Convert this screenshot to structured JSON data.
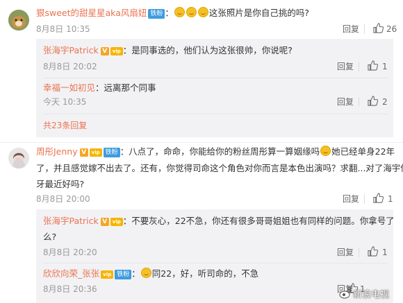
{
  "colors": {
    "accent": "#eb7350",
    "badge": "#3e9cde",
    "vip": "#f7b500",
    "panel": "#f2f2f5"
  },
  "labels": {
    "reply": "回复",
    "fan_badge": "铁粉",
    "v_badge": "V",
    "vip_badge": "vip"
  },
  "comment1": {
    "user": "狠sweet的甜星星aka风扇妞",
    "text": "这张照片是你自己挑的吗?",
    "time": "8月8日 10:35",
    "likes": "26",
    "replies": [
      {
        "user": "张海宇Patrick",
        "text": "是同事选的，他们认为这张很帅，你说呢?",
        "time": "8月8日 20:02",
        "likes": "1"
      },
      {
        "user": "幸福一如初见",
        "text": "远离那个同事",
        "time": "今天 10:35",
        "likes": "2"
      }
    ],
    "more": "共23条回复"
  },
  "comment2": {
    "user": "周彤Jenny",
    "text_line1_a": "八点了，命命，你能给你的粉丝周彤算一算姻缘吗",
    "text_line1_b": "她已经单身22年",
    "text_line2": "了，并且感觉嫁不出去了。还有，你觉得司命这个角色对你而言是本色出演吗？求翻...对了海宇你",
    "text_line3": "牙最近好吗?",
    "time": "8月8日 20:00",
    "likes": "1",
    "replies": [
      {
        "user": "张海宇Patrick",
        "text_line1": "不要灰心，22不急，你还有很多哥哥姐姐也有同样的问题。你拿号了",
        "text_line2": "么?",
        "time": "8月8日 20:20",
        "likes": "1"
      },
      {
        "user": "欣欣向荣_张张",
        "text": "同22，好，听司命的，不急",
        "time": "8月8日 20:36",
        "likes": "1"
      }
    ]
  },
  "watermark": "新浪电视"
}
